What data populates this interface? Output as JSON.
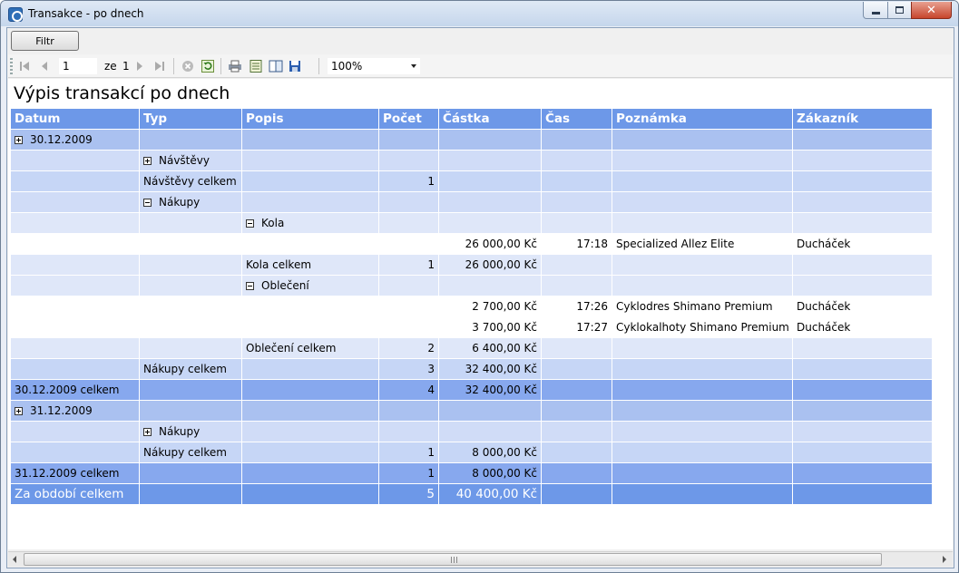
{
  "window": {
    "title": "Transakce - po dnech"
  },
  "filter": {
    "label": "Filtr"
  },
  "toolbar": {
    "page_value": "1",
    "of_label": "ze",
    "page_total": "1",
    "zoom": "100%"
  },
  "report": {
    "title": "Výpis transakcí po dnech",
    "columns": [
      "Datum",
      "Typ",
      "Popis",
      "Počet",
      "Částka",
      "Čas",
      "Poznámka",
      "Zákazník"
    ],
    "rows": [
      [
        "30.12.2009",
        "",
        "",
        "",
        "",
        "",
        "",
        ""
      ],
      [
        "",
        "Návštěvy",
        "",
        "",
        "",
        "",
        "",
        ""
      ],
      [
        "",
        "Návštěvy celkem",
        "",
        "1",
        "",
        "",
        "",
        ""
      ],
      [
        "",
        "Nákupy",
        "",
        "",
        "",
        "",
        "",
        ""
      ],
      [
        "",
        "",
        "Kola",
        "",
        "",
        "",
        "",
        ""
      ],
      [
        "",
        "",
        "",
        "",
        "26 000,00 Kč",
        "17:18",
        "Specialized Allez Elite",
        "Ducháček"
      ],
      [
        "",
        "",
        "Kola celkem",
        "1",
        "26 000,00 Kč",
        "",
        "",
        ""
      ],
      [
        "",
        "",
        "Oblečení",
        "",
        "",
        "",
        "",
        ""
      ],
      [
        "",
        "",
        "",
        "",
        "2 700,00 Kč",
        "17:26",
        "Cyklodres Shimano Premium",
        "Ducháček"
      ],
      [
        "",
        "",
        "",
        "",
        "3 700,00 Kč",
        "17:27",
        "Cyklokalhoty Shimano Premium",
        "Ducháček"
      ],
      [
        "",
        "",
        "Oblečení celkem",
        "2",
        "6 400,00 Kč",
        "",
        "",
        ""
      ],
      [
        "",
        "Nákupy celkem",
        "",
        "3",
        "32 400,00 Kč",
        "",
        "",
        ""
      ],
      [
        "30.12.2009 celkem",
        "",
        "",
        "4",
        "32 400,00 Kč",
        "",
        "",
        ""
      ],
      [
        "31.12.2009",
        "",
        "",
        "",
        "",
        "",
        "",
        ""
      ],
      [
        "",
        "Nákupy",
        "",
        "",
        "",
        "",
        "",
        ""
      ],
      [
        "",
        "Nákupy celkem",
        "",
        "1",
        "8 000,00 Kč",
        "",
        "",
        ""
      ],
      [
        "31.12.2009 celkem",
        "",
        "",
        "1",
        "8 000,00 Kč",
        "",
        "",
        ""
      ],
      [
        "Za období celkem",
        "",
        "",
        "5",
        "40 400,00 Kč",
        "",
        "",
        ""
      ]
    ]
  }
}
